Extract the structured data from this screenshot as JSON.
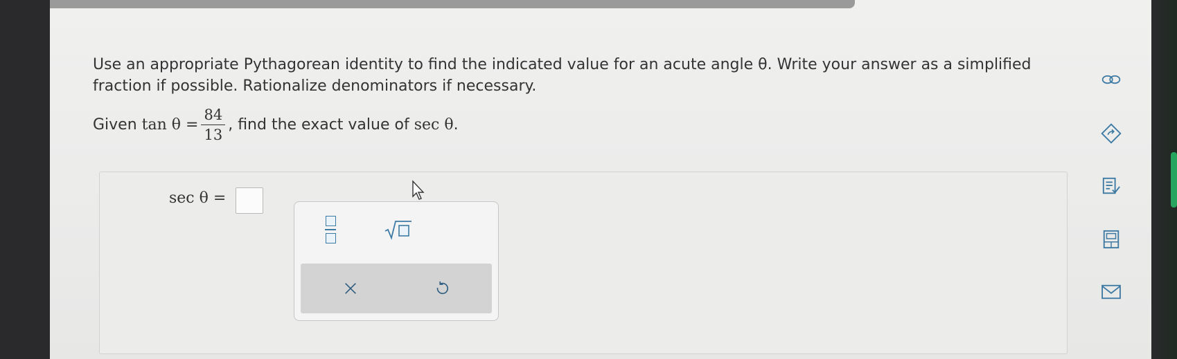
{
  "question": {
    "prompt": "Use an appropriate Pythagorean identity to find the indicated value for an acute angle θ. Write your answer as a simplified fraction if possible. Rationalize denominators if necessary.",
    "given_prefix": "Given",
    "given_func": "tan θ =",
    "numerator": "84",
    "denominator": "13",
    "given_suffix": ", find the exact value of",
    "target_func": "sec θ",
    "period": "."
  },
  "answer": {
    "label": "sec θ =",
    "value": ""
  },
  "palette": {
    "tools": [
      "fraction-tool",
      "square-root-tool"
    ],
    "actions": [
      "clear-icon",
      "undo-icon"
    ]
  },
  "sidebar": {
    "icons": [
      "link-icon",
      "rotate-icon",
      "checklist-icon",
      "calculator-icon",
      "mail-icon"
    ]
  },
  "colors": {
    "accent": "#3d7aa3",
    "action_bar": "#d3d3d3",
    "page_background": "#ececeb"
  }
}
